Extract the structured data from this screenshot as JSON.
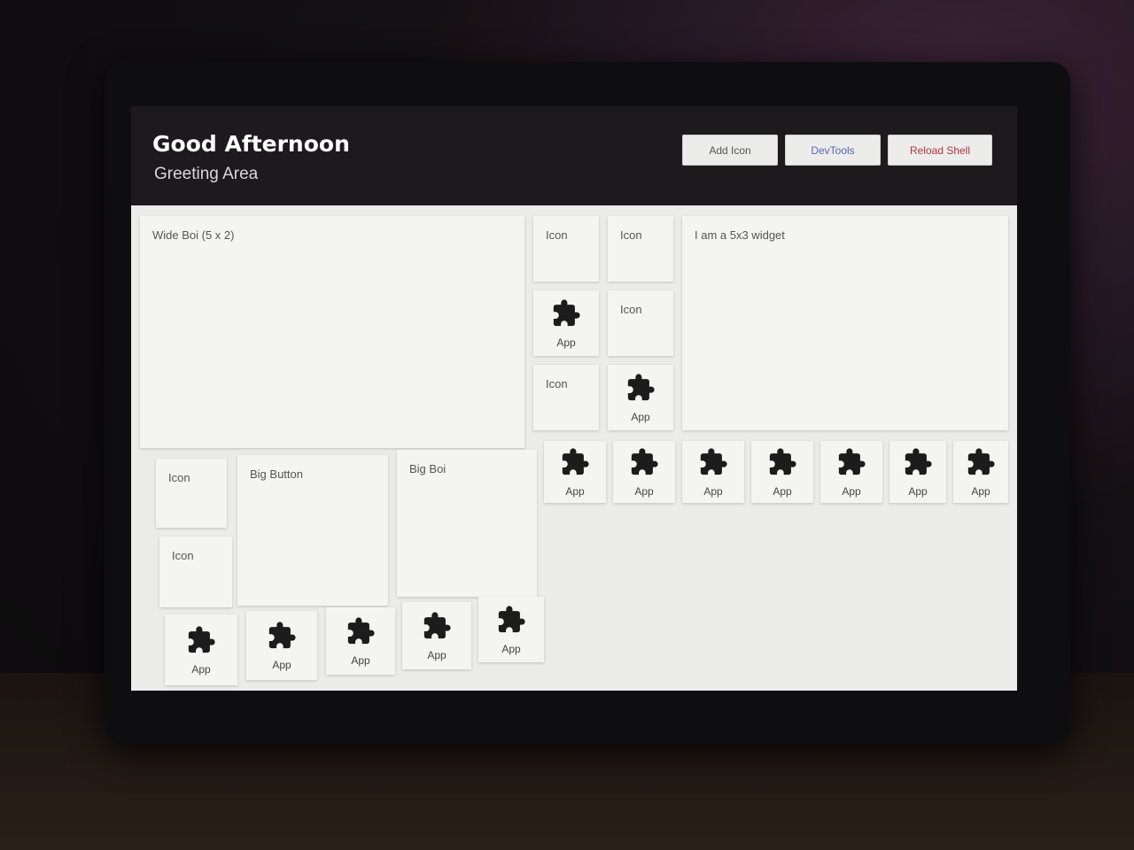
{
  "header": {
    "greeting": "Good Afternoon",
    "subtitle": "Greeting Area",
    "buttons": {
      "add_icon": "Add Icon",
      "devtools": "DevTools",
      "reload_shell": "Reload Shell"
    }
  },
  "widgets": {
    "wide": "Wide Boi (5 x 2)",
    "five_by_three": "I am a 5x3 widget",
    "big_button": "Big Button",
    "big": "Big Boi"
  },
  "icon_label": "Icon",
  "app_label": "App",
  "icon_name": "puzzle-icon",
  "colors": {
    "devtools": "#5568b3",
    "reload": "#b0353f",
    "header_bg": "#1c1a1c",
    "grid_bg": "#ebebea"
  }
}
